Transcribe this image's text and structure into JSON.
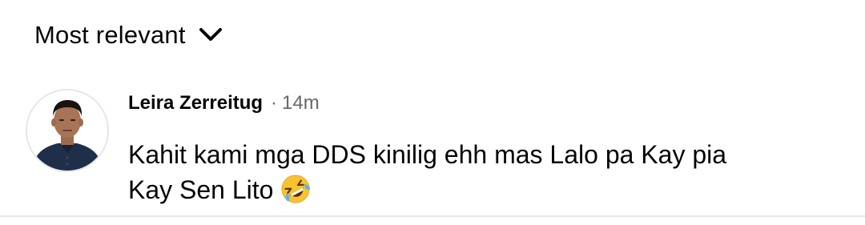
{
  "sort": {
    "label": "Most relevant"
  },
  "comment": {
    "author": "Leira Zerreitug",
    "separator": "·",
    "time": "14m",
    "text_line1": "Kahit kami mga DDS kinilig ehh mas Lalo pa Kay pia",
    "text_line2": "Kay Sen Lito",
    "emoji": "rolling-on-floor-laughing-emoji"
  },
  "colors": {
    "text": "#050505",
    "secondary_text": "#65676b",
    "divider": "#e4e6eb"
  }
}
